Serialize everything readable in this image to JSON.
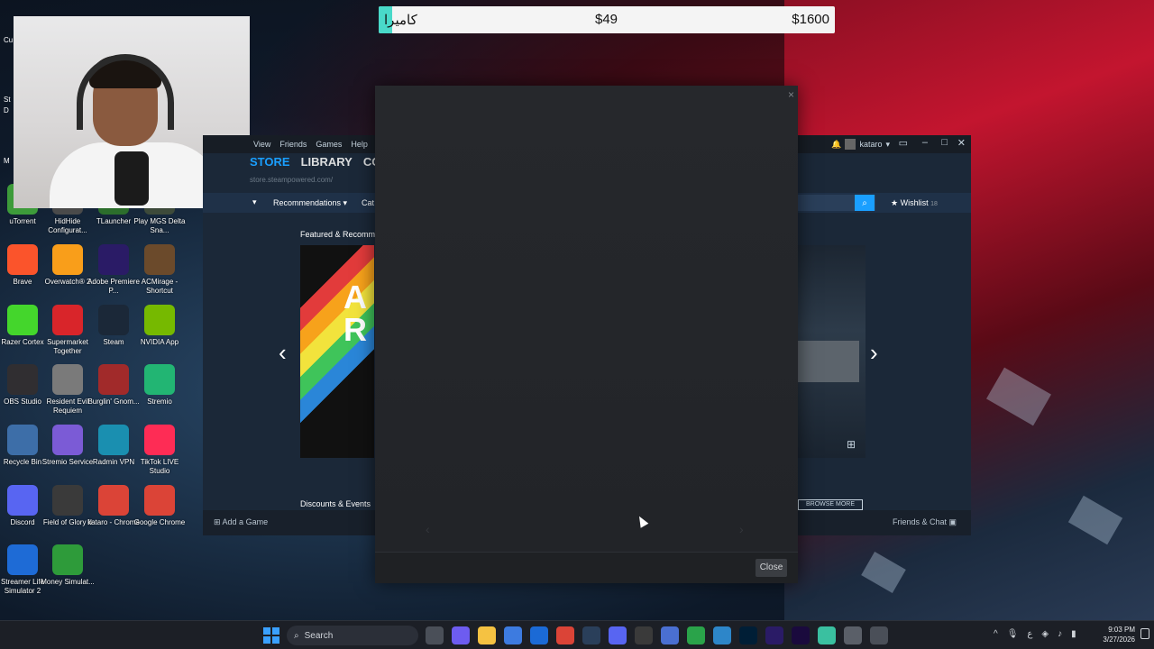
{
  "stream_overlay": {
    "goal_title": "كاميرا",
    "goal_current": "$49",
    "goal_target": "$1600",
    "goal_progress": 0.03
  },
  "desktop_icons": [
    {
      "label": "uTorrent",
      "icon": "utorrent-icon",
      "color": "#3d9b3a"
    },
    {
      "label": "HidHide Configurat...",
      "icon": "hidhide-icon",
      "color": "#4a4a4a"
    },
    {
      "label": "TLauncher",
      "icon": "tlauncher-icon",
      "color": "#2c6e2c"
    },
    {
      "label": "Play MGS Delta Sna...",
      "icon": "mgs-icon",
      "color": "#3d4a3a"
    },
    {
      "label": "Brave",
      "icon": "brave-icon",
      "color": "#fb542b"
    },
    {
      "label": "Overwatch® 2",
      "icon": "overwatch-icon",
      "color": "#f99e1a"
    },
    {
      "label": "Adobe Premiere P...",
      "icon": "premiere-icon",
      "color": "#2a1b66"
    },
    {
      "label": "ACMirage - Shortcut",
      "icon": "acmirage-icon",
      "color": "#6b4a2b"
    },
    {
      "label": "Razer Cortex",
      "icon": "razer-icon",
      "color": "#44d62c"
    },
    {
      "label": "Supermarket Together",
      "icon": "supermarket-icon",
      "color": "#d9252a"
    },
    {
      "label": "Steam",
      "icon": "steam-icon",
      "color": "#1b2838"
    },
    {
      "label": "NVIDIA App",
      "icon": "nvidia-icon",
      "color": "#76b900"
    },
    {
      "label": "OBS Studio",
      "icon": "obs-icon",
      "color": "#302e31"
    },
    {
      "label": "Resident Evil Requiem",
      "icon": "resident-evil-icon",
      "color": "#7a7a7a"
    },
    {
      "label": "Burglin' Gnom...",
      "icon": "burglin-icon",
      "color": "#a12a2a"
    },
    {
      "label": "Stremio",
      "icon": "stremio-icon",
      "color": "#22b573"
    },
    {
      "label": "Recycle Bin",
      "icon": "recycle-bin-icon",
      "color": "#3d6ea8"
    },
    {
      "label": "Stremio Service",
      "icon": "stremio-service-icon",
      "color": "#7b5bd6"
    },
    {
      "label": "Radmin VPN",
      "icon": "radmin-icon",
      "color": "#1a8fb0"
    },
    {
      "label": "TikTok LIVE Studio",
      "icon": "tiktok-icon",
      "color": "#fe2c55"
    },
    {
      "label": "Discord",
      "icon": "discord-icon",
      "color": "#5865f2"
    },
    {
      "label": "Field of Glory II",
      "icon": "field-of-glory-icon",
      "color": "#3a3a3a"
    },
    {
      "label": "kataro - Chrome",
      "icon": "chrome-icon",
      "color": "#db4437"
    },
    {
      "label": "Google Chrome",
      "icon": "chrome-icon",
      "color": "#db4437"
    },
    {
      "label": "Streamer Life Simulator 2",
      "icon": "streamer-life-icon",
      "color": "#1e6bd6"
    },
    {
      "label": "Money Simulat...",
      "icon": "money-sim-icon",
      "color": "#2e9b3a"
    }
  ],
  "desktop_edge_labels": [
    "Cu",
    "St",
    "D",
    "M"
  ],
  "steam": {
    "menu": [
      "View",
      "Friends",
      "Games",
      "Help"
    ],
    "username": "kataro",
    "nav": [
      "STORE",
      "LIBRARY",
      "COM"
    ],
    "url": "store.steampowered.com/",
    "recommendations": "Recommendations",
    "categories": "Cat",
    "wishlist_label": "Wishlist",
    "wishlist_count": "18",
    "featured_title": "Featured & Recomm",
    "featured_art_text": "A R",
    "discounts_title": "Discounts & Events",
    "browse_more": "BROWSE MORE",
    "add_game": "Add a Game",
    "friends_chat": "Friends & Chat"
  },
  "modal": {
    "close_label": "Close",
    "close_x": "×"
  },
  "taskbar": {
    "search_placeholder": "Search",
    "apps": [
      {
        "icon": "task-view-icon",
        "color": "#4a4f58"
      },
      {
        "icon": "copilot-icon",
        "color": "#6d5cf0"
      },
      {
        "icon": "file-explorer-icon",
        "color": "#f5c242"
      },
      {
        "icon": "store-icon",
        "color": "#3d7be0"
      },
      {
        "icon": "outlook-icon",
        "color": "#1b6ad6"
      },
      {
        "icon": "chrome-icon",
        "color": "#db4437"
      },
      {
        "icon": "steam-icon",
        "color": "#2a3f5a"
      },
      {
        "icon": "discord-icon",
        "color": "#5865f2"
      },
      {
        "icon": "obs-icon",
        "color": "#3a3a3a"
      },
      {
        "icon": "gamepad-icon",
        "color": "#4a6fd1"
      },
      {
        "icon": "xbox-icon",
        "color": "#2aa34a"
      },
      {
        "icon": "edge-icon",
        "color": "#2d86c9"
      },
      {
        "icon": "photoshop-icon",
        "color": "#001e36"
      },
      {
        "icon": "premiere-icon",
        "color": "#2a1b66"
      },
      {
        "icon": "after-effects-icon",
        "color": "#1a0a3d"
      },
      {
        "icon": "app-bar-icon",
        "color": "#3ac0a0"
      },
      {
        "icon": "settings-icon",
        "color": "#5a5f68"
      },
      {
        "icon": "gear-icon",
        "color": "#4a4f58"
      }
    ],
    "tray": [
      "^",
      "mic",
      "ع",
      "net",
      "vol",
      "bat"
    ],
    "time": "9:03 PM",
    "date": "3/27/2026"
  }
}
